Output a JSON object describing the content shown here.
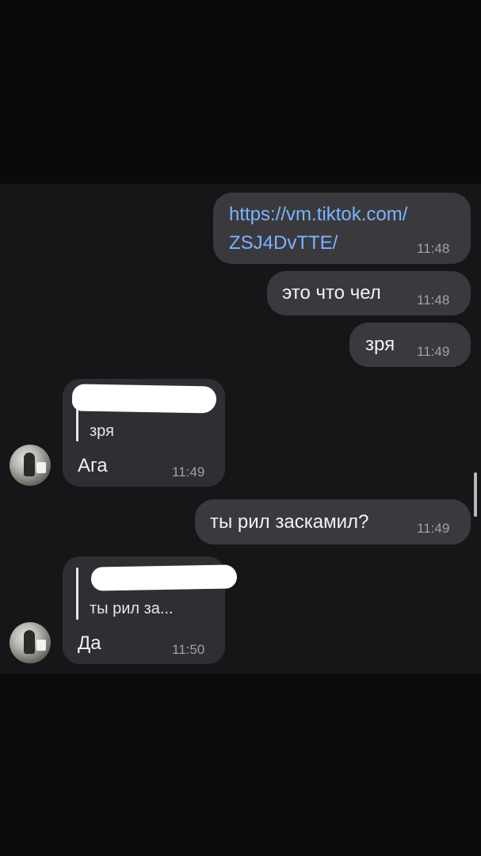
{
  "messages": [
    {
      "direction": "outgoing",
      "type": "link",
      "lines": [
        "https://vm.tiktok.com/",
        "ZSJ4DvTTE/"
      ],
      "time": "11:48"
    },
    {
      "direction": "outgoing",
      "type": "text",
      "text": "это что чел",
      "time": "11:48"
    },
    {
      "direction": "outgoing",
      "type": "text",
      "text": "зря",
      "time": "11:49"
    },
    {
      "direction": "incoming",
      "type": "reply",
      "quoted_text": "зря",
      "text": "Ага",
      "time": "11:49"
    },
    {
      "direction": "outgoing",
      "type": "text",
      "text": "ты рил заскамил?",
      "time": "11:49"
    },
    {
      "direction": "incoming",
      "type": "reply",
      "quoted_text": "ты рил за...",
      "text": "Да",
      "time": "11:50"
    }
  ],
  "colors": {
    "background": "#161618",
    "outgoing_bubble": "#3a3a3e",
    "incoming_bubble": "#2f2f33",
    "link": "#7db3ff",
    "time": "#a0a0a6"
  },
  "icons": {
    "avatar": "user-avatar-photo",
    "redaction": "white-marker-redaction"
  }
}
